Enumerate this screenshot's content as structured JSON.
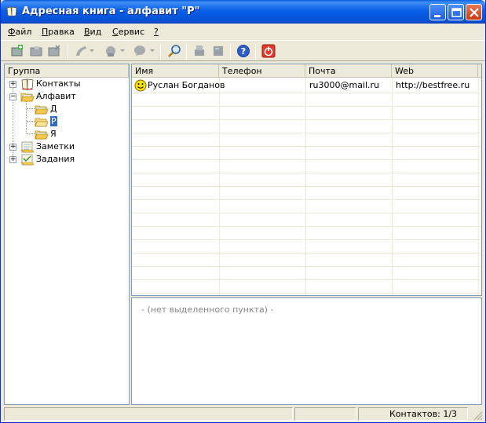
{
  "window": {
    "title": "Адресная книга - алфавит \"P\""
  },
  "menu": {
    "items": [
      {
        "label": "Файл"
      },
      {
        "label": "Правка"
      },
      {
        "label": "Вид"
      },
      {
        "label": "Сервис"
      },
      {
        "label": "?"
      }
    ]
  },
  "toolbar": {
    "icons": [
      "new-contact-icon",
      "open-folder-icon",
      "delete-icon",
      "phone-icon",
      "mail-icon",
      "chat-icon",
      "find-icon",
      "print-icon",
      "book-icon",
      "help-icon",
      "exit-icon"
    ]
  },
  "tree": {
    "header": "Группа",
    "items": [
      {
        "label": "Контакты",
        "icon": "contacts-book-icon"
      },
      {
        "label": "Алфавит",
        "icon": "folder-open-icon"
      },
      {
        "label": "Д",
        "icon": "folder-icon"
      },
      {
        "label": "P",
        "icon": "folder-open-icon",
        "selected": true
      },
      {
        "label": "Я",
        "icon": "folder-icon"
      },
      {
        "label": "Заметки",
        "icon": "notes-icon"
      },
      {
        "label": "Задания",
        "icon": "tasks-icon"
      }
    ]
  },
  "list": {
    "columns": [
      "Имя",
      "Телефон",
      "Почта",
      "Web"
    ],
    "rows": [
      {
        "name": "Руслан Богданов",
        "phone": "",
        "email": "ru3000@mail.ru",
        "web": "http://bestfree.ru",
        "icon": "smiley-icon"
      }
    ]
  },
  "details": {
    "placeholder": "- (нет выделенного пункта) -"
  },
  "status": {
    "count": "Контактов: 1/3"
  }
}
